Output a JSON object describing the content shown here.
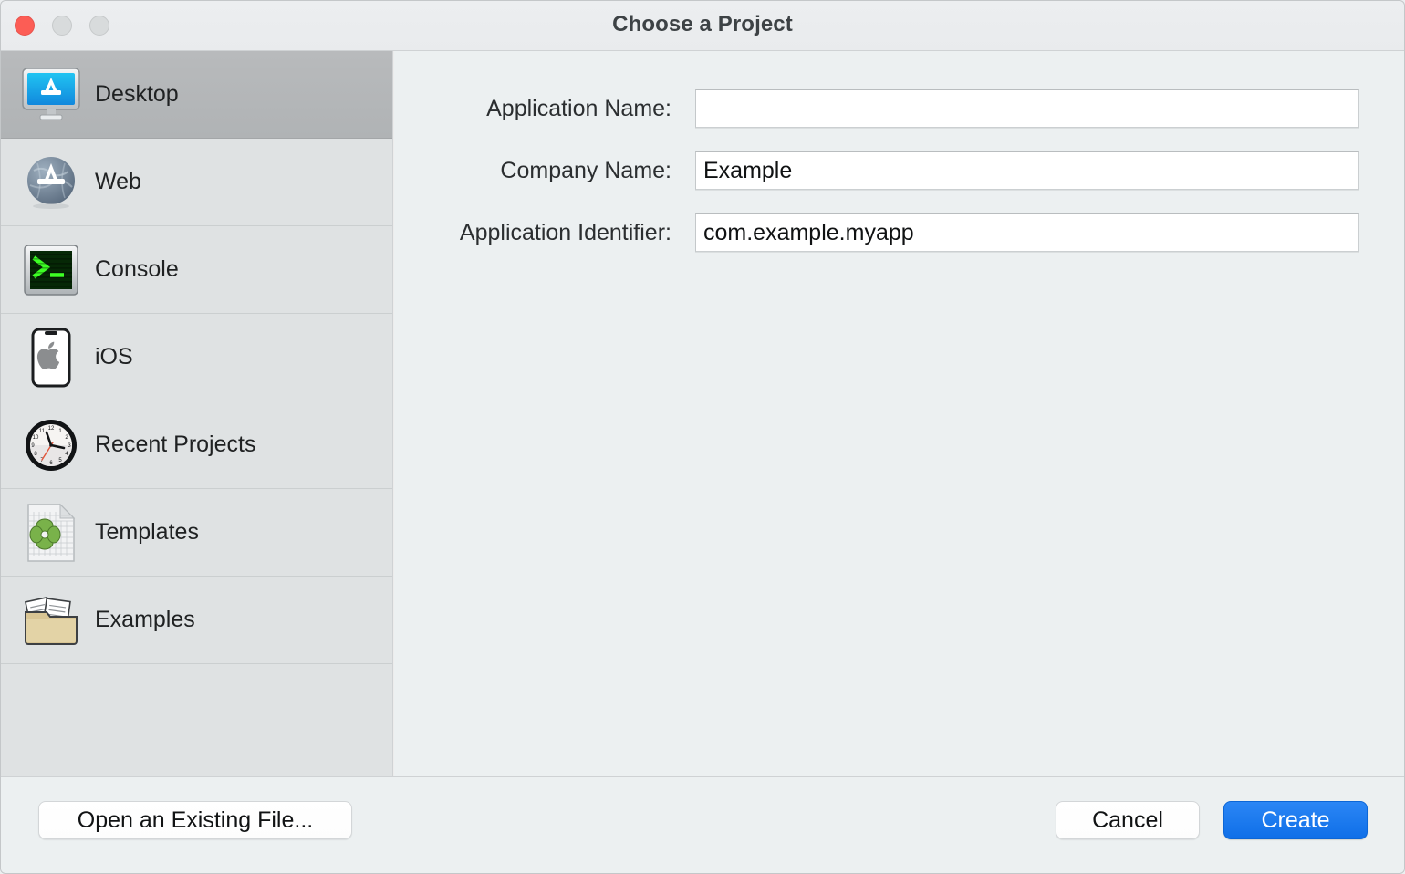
{
  "window": {
    "title": "Choose a Project",
    "traffic_lights": [
      {
        "name": "close",
        "color": "#fc5d55"
      },
      {
        "name": "minimize",
        "color": "#d8dbdc"
      },
      {
        "name": "zoom",
        "color": "#d8dbdc"
      }
    ]
  },
  "sidebar": {
    "items": [
      {
        "label": "Desktop",
        "icon": "desktop-monitor-icon",
        "selected": true
      },
      {
        "label": "Web",
        "icon": "globe-icon",
        "selected": false
      },
      {
        "label": "Console",
        "icon": "terminal-icon",
        "selected": false
      },
      {
        "label": "iOS",
        "icon": "iphone-apple-icon",
        "selected": false
      },
      {
        "label": "Recent Projects",
        "icon": "clock-icon",
        "selected": false
      },
      {
        "label": "Templates",
        "icon": "template-document-icon",
        "selected": false
      },
      {
        "label": "Examples",
        "icon": "folder-documents-icon",
        "selected": false
      }
    ]
  },
  "form": {
    "fields": [
      {
        "label": "Application Name:",
        "value": "",
        "placeholder": ""
      },
      {
        "label": "Company Name:",
        "value": "Example",
        "placeholder": ""
      },
      {
        "label": "Application Identifier:",
        "value": "com.example.myapp",
        "placeholder": ""
      }
    ]
  },
  "footer": {
    "open_existing_label": "Open an Existing File...",
    "cancel_label": "Cancel",
    "create_label": "Create",
    "create_accent": "#0f6fe8"
  }
}
